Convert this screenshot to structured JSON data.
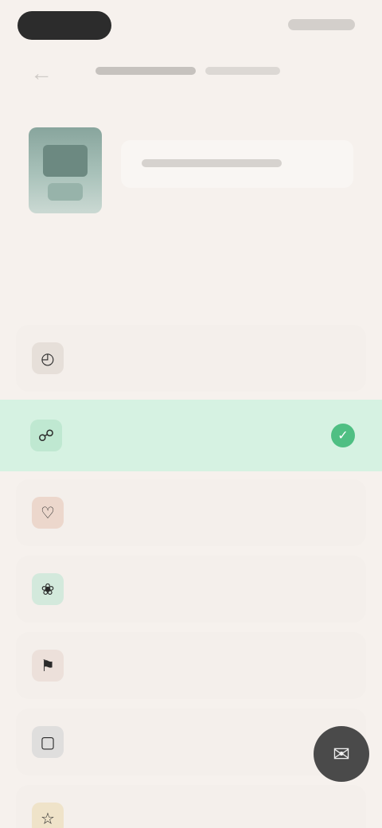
{
  "header": {
    "back_icon": "arrow-left-icon"
  },
  "product": {
    "thumbnail": "product-thumbnail"
  },
  "question": {
    "text": ""
  },
  "options": [
    {
      "icon": "clock-icon",
      "label": "",
      "color": "#e6dfd9",
      "selected": false
    },
    {
      "icon": "shield-icon",
      "label": "",
      "color": "#bfe8d1",
      "selected": true
    },
    {
      "icon": "heart-icon",
      "label": "",
      "color": "#ecd7cc",
      "selected": false
    },
    {
      "icon": "leaf-icon",
      "label": "",
      "color": "#d3e9dc",
      "selected": false
    },
    {
      "icon": "tag-icon",
      "label": "",
      "color": "#ece0da",
      "selected": false
    },
    {
      "icon": "box-icon",
      "label": "",
      "color": "#dfdedd",
      "selected": false
    },
    {
      "icon": "star-icon",
      "label": "",
      "color": "#efe3c9",
      "selected": false
    }
  ],
  "colors": {
    "accent": "#4fbf83",
    "selected_bg": "#d6f2e2",
    "background": "#f6f1ed"
  },
  "fab": {
    "icon": "chat-icon"
  }
}
